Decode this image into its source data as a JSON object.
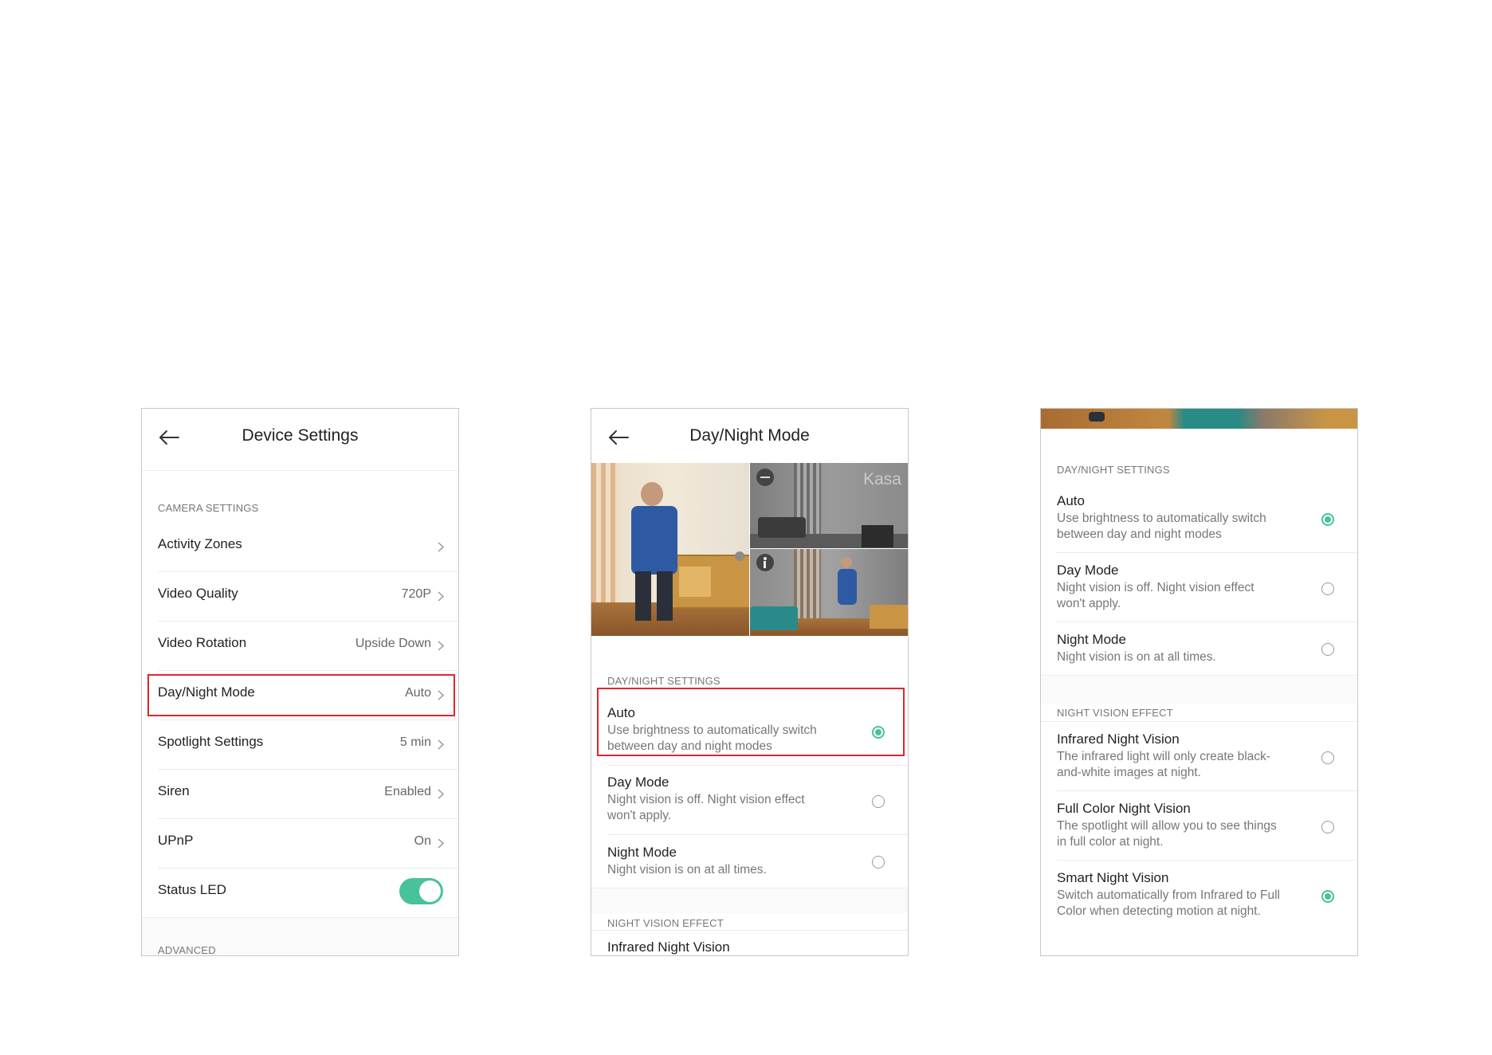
{
  "panel1": {
    "title": "Device Settings",
    "section_camera": "CAMERA SETTINGS",
    "rows": [
      {
        "label": "Activity Zones",
        "value": ""
      },
      {
        "label": "Video Quality",
        "value": "720P"
      },
      {
        "label": "Video Rotation",
        "value": "Upside Down"
      },
      {
        "label": "Day/Night Mode",
        "value": "Auto"
      },
      {
        "label": "Spotlight Settings",
        "value": "5 min"
      },
      {
        "label": "Siren",
        "value": "Enabled"
      },
      {
        "label": "UPnP",
        "value": "On"
      },
      {
        "label": "Status LED",
        "value": "on"
      }
    ],
    "section_advanced": "ADVANCED"
  },
  "panel2": {
    "title": "Day/Night Mode",
    "camera_brand": "Kasa",
    "section_daynight": "DAY/NIGHT SETTINGS",
    "options": [
      {
        "title": "Auto",
        "desc": "Use brightness to automatically switch between day and night modes",
        "selected": true
      },
      {
        "title": "Day Mode",
        "desc": "Night vision is off. Night vision effect won't apply.",
        "selected": false
      },
      {
        "title": "Night Mode",
        "desc": "Night vision is on at all times.",
        "selected": false
      }
    ],
    "section_nightvision": "NIGHT VISION EFFECT",
    "partial_option": "Infrared Night Vision"
  },
  "panel3": {
    "section_daynight": "DAY/NIGHT SETTINGS",
    "options": [
      {
        "title": "Auto",
        "desc": "Use brightness to automatically switch between day and night modes",
        "selected": true
      },
      {
        "title": "Day Mode",
        "desc": "Night vision is off. Night vision effect won't apply.",
        "selected": false
      },
      {
        "title": "Night Mode",
        "desc": "Night vision is on at all times.",
        "selected": false
      }
    ],
    "section_nightvision": "NIGHT VISION EFFECT",
    "effects": [
      {
        "title": "Infrared Night Vision",
        "desc": "The infrared light will only create black-and-white images at night.",
        "selected": false
      },
      {
        "title": "Full Color Night Vision",
        "desc": "The spotlight will allow you to see things in full color at night.",
        "selected": false
      },
      {
        "title": "Smart Night Vision",
        "desc": "Switch automatically from Infrared to Full Color when detecting motion at night.",
        "selected": true
      }
    ]
  },
  "colors": {
    "accent": "#48c29b",
    "highlight": "#e0262f"
  }
}
